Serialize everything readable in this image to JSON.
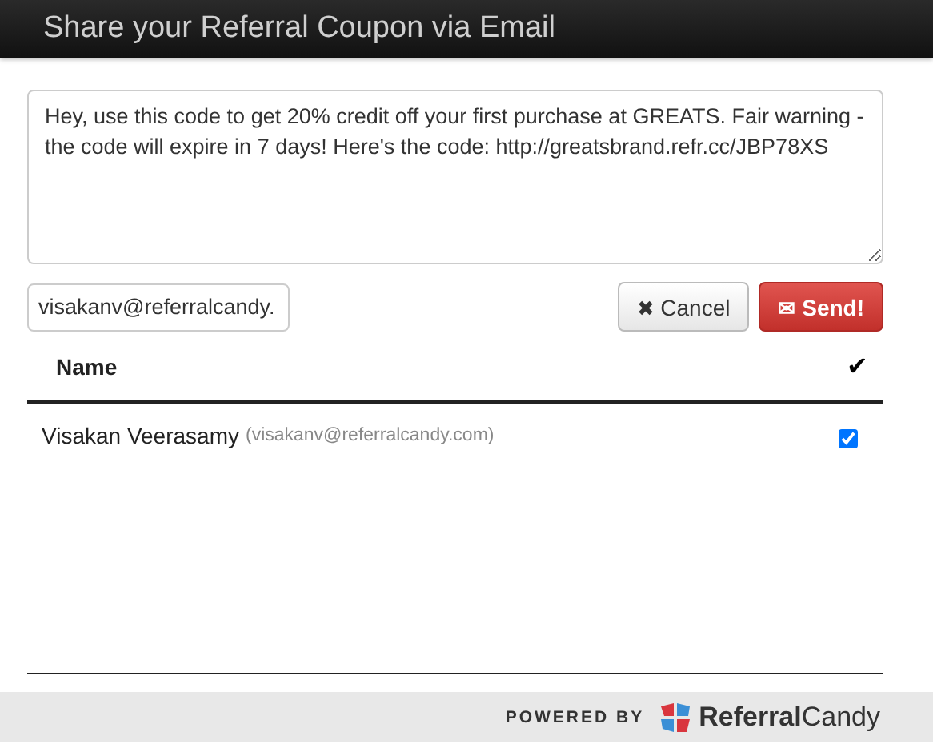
{
  "window": {
    "title": "Share your Referral Coupon via Email"
  },
  "message": {
    "value": "Hey, use this code to get 20% credit off your first purchase at GREATS. Fair warning - the code will expire in 7 days! Here's the code: http://greatsbrand.refr.cc/JBP78XS"
  },
  "email_field": {
    "value": "visakanv@referralcandy."
  },
  "buttons": [
    {
      "kind": "cancel",
      "icon": "✖",
      "label": "Cancel"
    },
    {
      "kind": "send",
      "icon": "✉",
      "label": "Send!"
    }
  ],
  "table": {
    "columns": [
      "Name",
      "✔"
    ],
    "rows": [
      {
        "name": "Visakan Veerasamy",
        "email": "(visakanv@referralcandy.com)",
        "checked": true
      }
    ]
  },
  "footer": {
    "powered_by": "POWERED BY",
    "brand": "**Referral**Candy"
  }
}
